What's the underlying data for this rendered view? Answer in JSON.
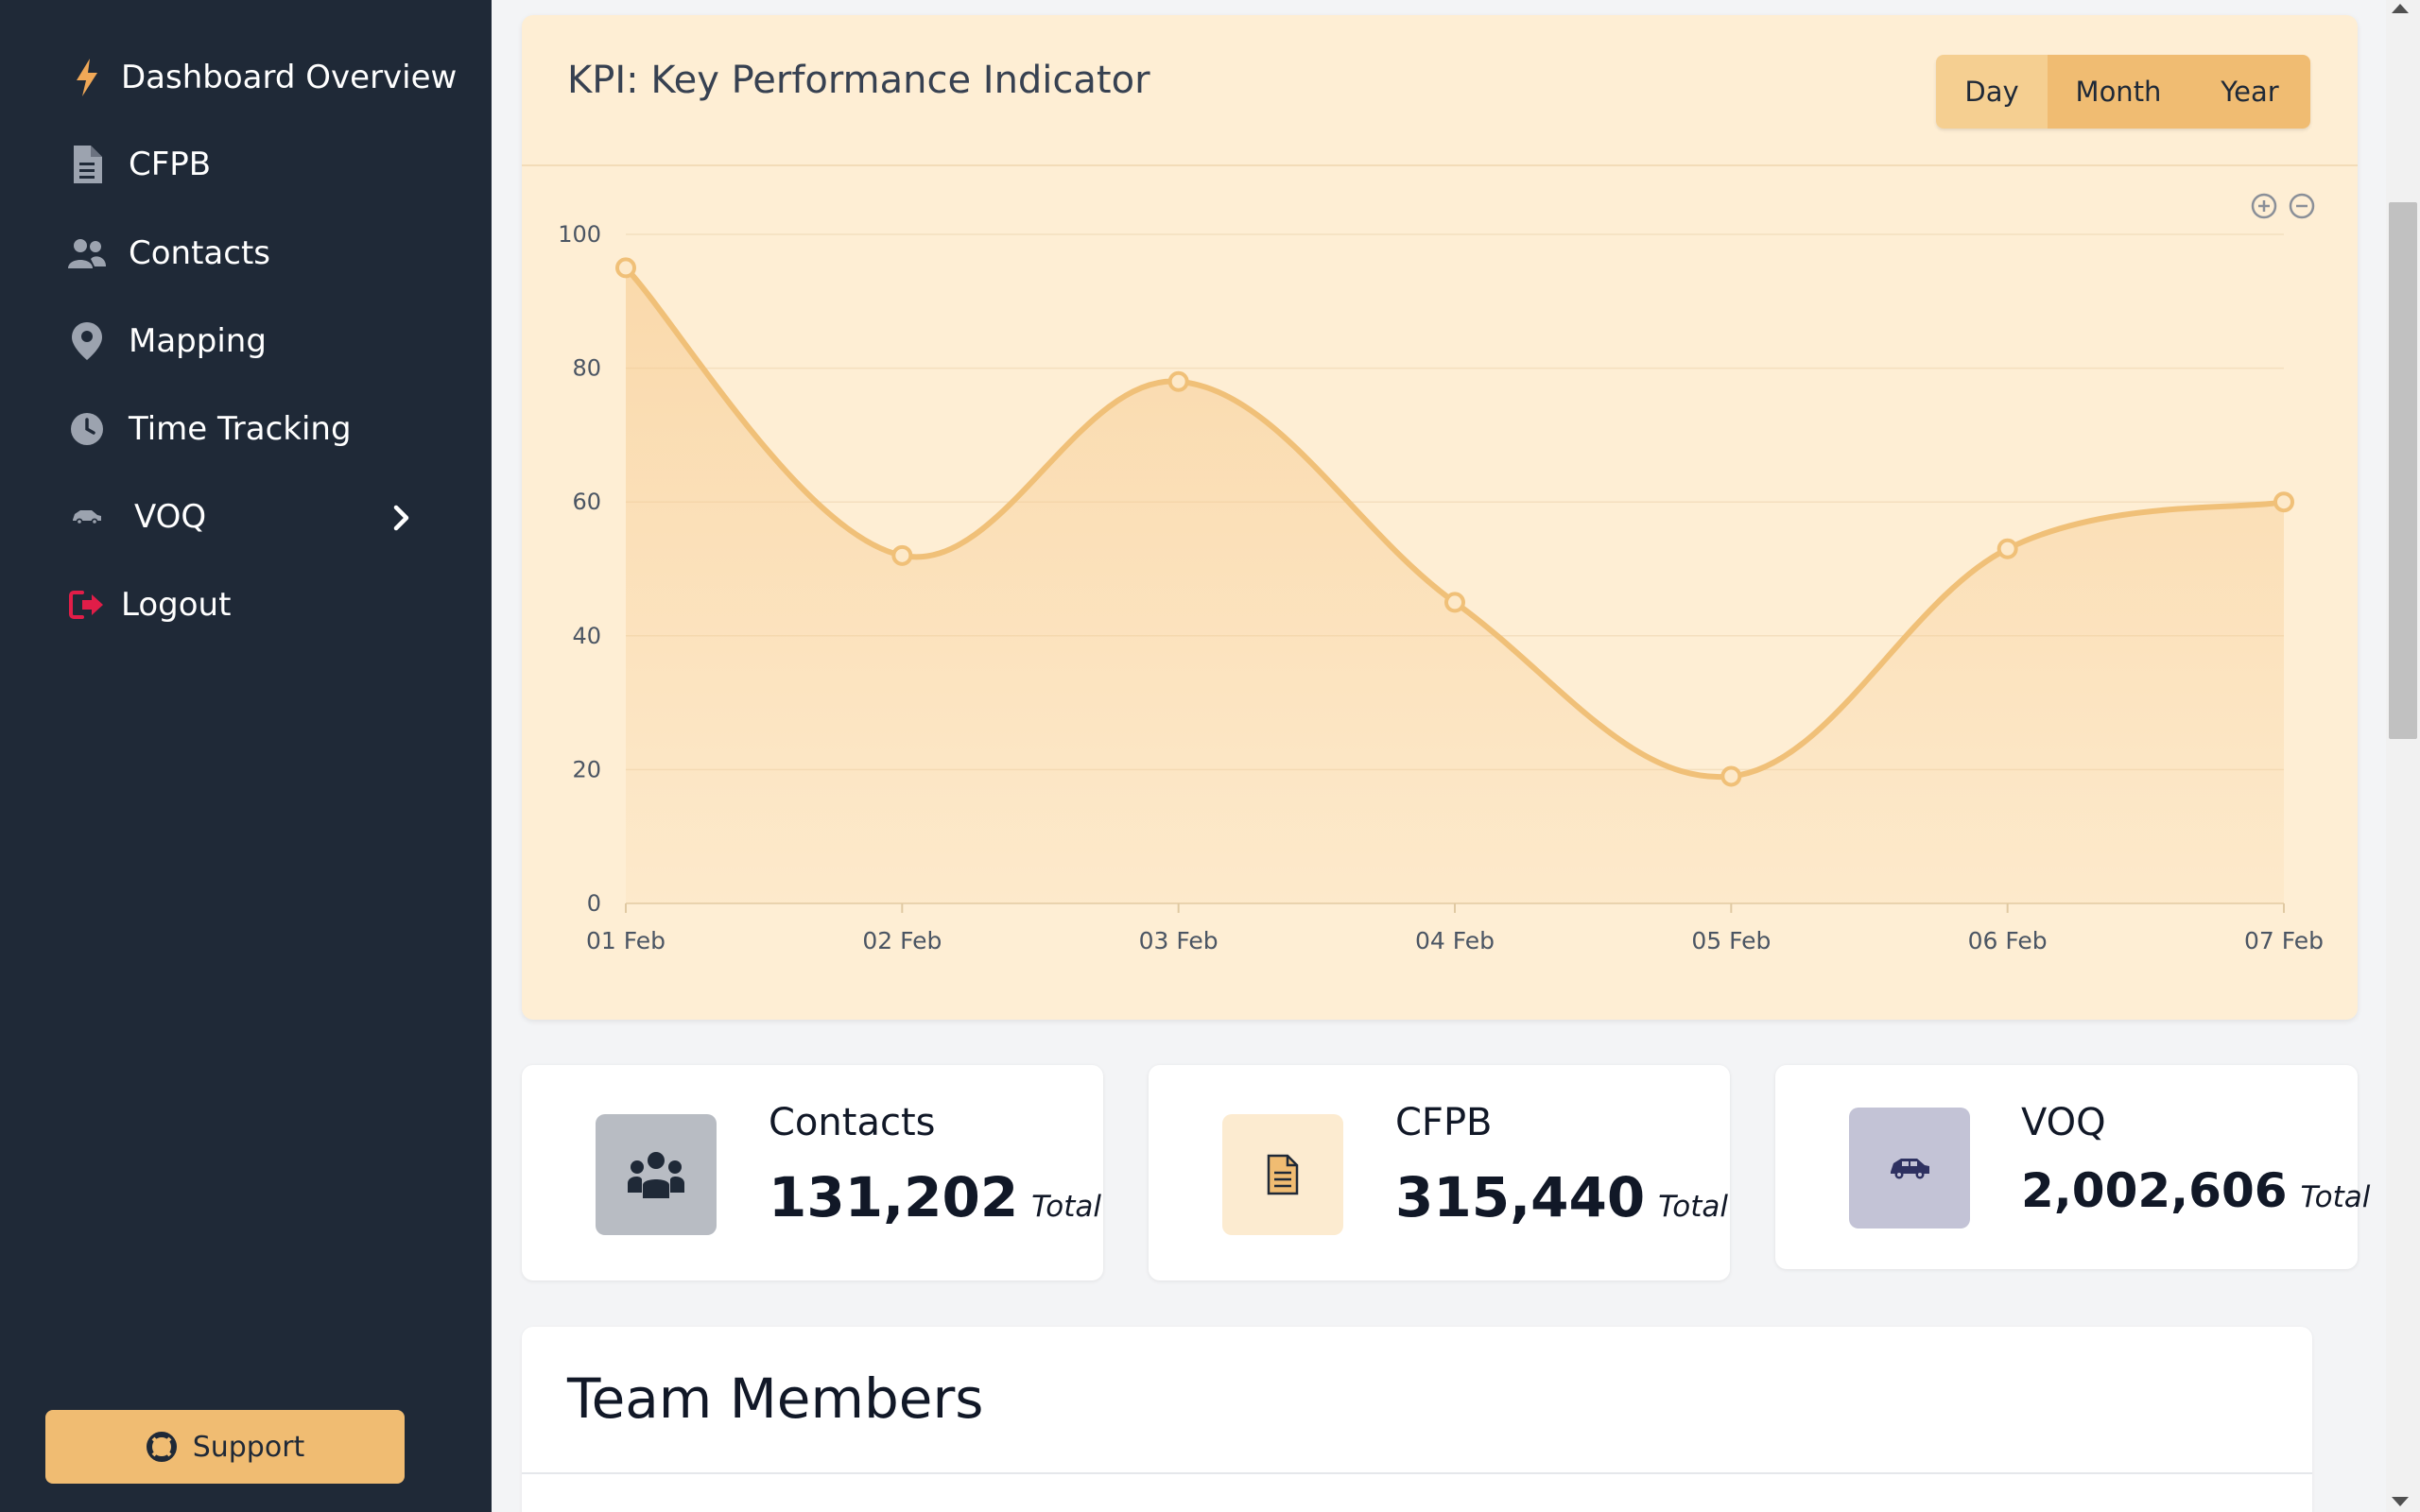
{
  "sidebar": {
    "items": [
      {
        "label": "Dashboard Overview",
        "icon": "bolt-icon"
      },
      {
        "label": "CFPB",
        "icon": "document-icon"
      },
      {
        "label": "Contacts",
        "icon": "users-icon"
      },
      {
        "label": "Mapping",
        "icon": "map-pin-icon"
      },
      {
        "label": "Time Tracking",
        "icon": "clock-icon"
      },
      {
        "label": "VOQ",
        "icon": "car-icon"
      },
      {
        "label": "Logout",
        "icon": "logout-icon"
      }
    ],
    "support_label": "Support"
  },
  "kpi": {
    "title": "KPI: Key Performance Indicator",
    "periods": [
      "Day",
      "Month",
      "Year"
    ],
    "active_period": "Day"
  },
  "chart_data": {
    "type": "area",
    "title": "",
    "xlabel": "",
    "ylabel": "",
    "x": [
      "01 Feb",
      "02 Feb",
      "03 Feb",
      "04 Feb",
      "05 Feb",
      "06 Feb",
      "07 Feb"
    ],
    "series": [
      {
        "values": [
          95,
          52,
          78,
          45,
          19,
          53,
          60
        ]
      }
    ],
    "ylim": [
      0,
      100
    ],
    "yticks": [
      0,
      20,
      40,
      60,
      80,
      100
    ],
    "grid": true,
    "colors": {
      "line": "#f0c078",
      "fill": "#f6c88a",
      "point": "#fde9c9"
    }
  },
  "stats": [
    {
      "label": "Contacts",
      "value": "131,202",
      "suffix": "Total",
      "icon": "users-group-icon",
      "tile_color": "#b8bcc3"
    },
    {
      "label": "CFPB",
      "value": "315,440",
      "suffix": "Total",
      "icon": "document-icon",
      "tile_color": "#fcebd0"
    },
    {
      "label": "VOQ",
      "value": "2,002,606",
      "suffix": "Total",
      "icon": "car-icon",
      "tile_color": "#c3c3d6"
    }
  ],
  "team": {
    "title": "Team Members"
  },
  "colors": {
    "sidebar": "#1f2937",
    "accent": "#f0bc72",
    "logout": "#e11d48"
  }
}
